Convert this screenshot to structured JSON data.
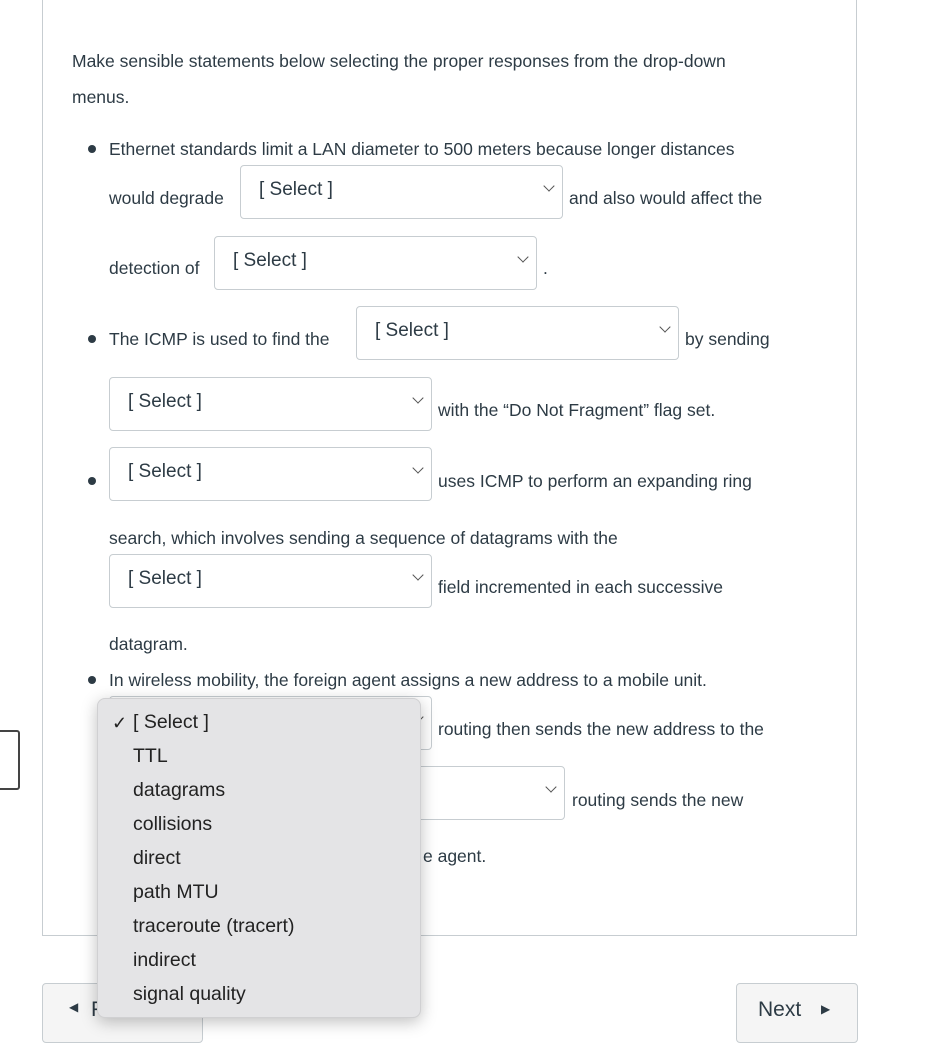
{
  "intro": {
    "line1": "Make sensible statements below selecting the proper responses from the drop-down",
    "line2": "menus."
  },
  "q1": {
    "line1": "Ethernet standards limit a LAN diameter to 500 meters because longer distances",
    "pre1": "would degrade",
    "select1": "[ Select ]",
    "post1": "and also would affect the",
    "pre2": "detection of",
    "select2": "[ Select ]",
    "post2": "."
  },
  "q2": {
    "pre1": "The ICMP is used to find the",
    "select1": "[ Select ]",
    "post1": "by sending",
    "select2": "[ Select ]",
    "post2": "with the “Do Not Fragment” flag set."
  },
  "q3": {
    "select1": "[ Select ]",
    "post1": "uses ICMP to perform an expanding ring",
    "line2": "search, which involves sending a sequence of datagrams with the",
    "select2": "[ Select ]",
    "post2": "field incremented in each successive",
    "line4": "datagram."
  },
  "q4": {
    "line1": "In wireless mobility, the foreign agent assigns a new address to a mobile unit.",
    "post1": "routing then sends the new address to the",
    "post2": "routing sends the new",
    "line4_fragment": "e agent."
  },
  "dropdown": {
    "selected": "[ Select ]",
    "check_icon": "checkmark-icon",
    "options": [
      "[ Select ]",
      "TTL",
      "datagrams",
      "collisions",
      "direct",
      "path MTU",
      "traceroute (tracert)",
      "indirect",
      "signal quality"
    ]
  },
  "nav": {
    "previous_label": "Previous",
    "next_label": "Next"
  }
}
